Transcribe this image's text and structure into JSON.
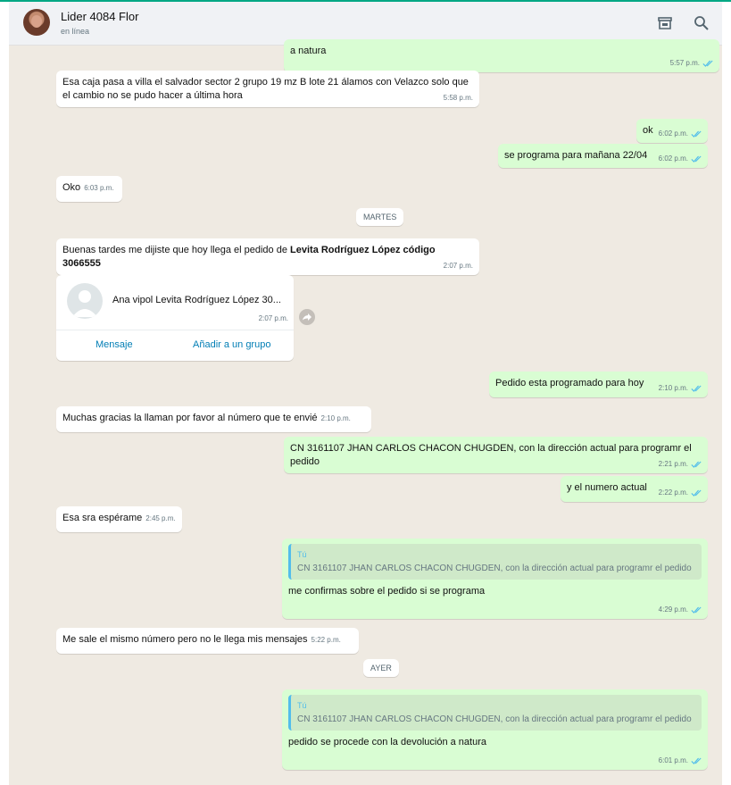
{
  "header": {
    "contact_name": "Lider 4084 Flor",
    "status": "en línea",
    "store_icon": "store-icon",
    "search_icon": "search-icon"
  },
  "colors": {
    "incoming_bubble": "#ffffff",
    "outgoing_bubble": "#d9fdd3",
    "read_tick": "#53bdeb",
    "link": "#027eb5"
  },
  "messages": {
    "m0": {
      "text": "a natura",
      "time": "5:57 p.m."
    },
    "m1": {
      "text": "Esa caja pasa a villa el salvador sector 2 grupo 19 mz B lote 21 álamos con Velazco solo que el cambio no se pudo hacer a última hora",
      "time": "5:58 p.m."
    },
    "m2": {
      "text": "ok",
      "time": "6:02 p.m."
    },
    "m3": {
      "text": "se programa para mañana 22/04",
      "time": "6:02 p.m."
    },
    "m4": {
      "text": "Oko",
      "time": "6:03 p.m."
    },
    "day1": "MARTES",
    "m5": {
      "text_a": "Buenas tardes me dijiste que hoy llega el pedido de ",
      "text_b": "Levita Rodríguez López código 3066555",
      "time": "2:07 p.m."
    },
    "contact_card": {
      "name": "Ana vipol Levita Rodríguez López 30...",
      "time": "2:07 p.m.",
      "message_btn": "Mensaje",
      "add_group_btn": "Añadir a un grupo"
    },
    "m6": {
      "text": "Pedido esta programado para hoy",
      "time": "2:10 p.m."
    },
    "m7": {
      "text": "Muchas gracias la llaman por favor al número que te envié",
      "time": "2:10 p.m."
    },
    "m8": {
      "text": "CN 3161107 JHAN CARLOS CHACON CHUGDEN, con la dirección actual para programr el pedido",
      "time": "2:21 p.m."
    },
    "m9": {
      "text": "y el numero actual",
      "time": "2:22 p.m."
    },
    "m10": {
      "text": "Esa sra espérame",
      "time": "2:45 p.m."
    },
    "m11": {
      "quote_author": "Tú",
      "quote_text": "CN 3161107 JHAN CARLOS CHACON CHUGDEN, con la dirección actual para programr el pedido",
      "text": "me confirmas sobre el pedido si se programa",
      "time": "4:29 p.m."
    },
    "m12": {
      "text": "Me sale el mismo número pero no le llega mis mensajes",
      "time": "5:22 p.m."
    },
    "day2": "AYER",
    "m13": {
      "quote_author": "Tú",
      "quote_text": "CN 3161107 JHAN CARLOS CHACON CHUGDEN, con la dirección actual para programr el pedido",
      "text": "pedido se procede con la devolución a natura",
      "time": "6:01 p.m."
    }
  }
}
